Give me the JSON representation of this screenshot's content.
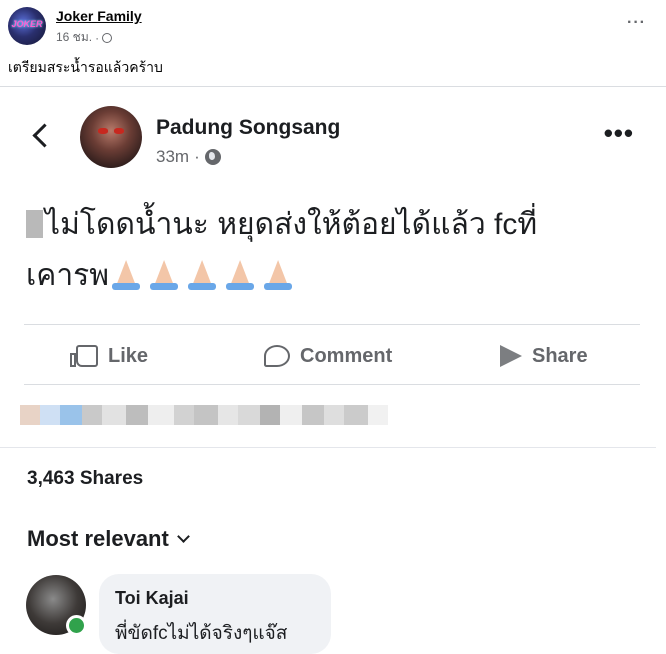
{
  "post": {
    "page_name": "Joker Family",
    "time": "16 ชม.",
    "separator": "·",
    "caption": "เตรียมสระน้ำรอแล้วคร้าบ",
    "more": "···",
    "avatar_text": "JOKER"
  },
  "shared": {
    "author": "Padung Songsang",
    "time": "33m",
    "separator": "·",
    "text_line1": "ไม่โดดน้ำนะ หยุดส่งให้ต้อยได้แล้ว fcที่",
    "text_line2": "เคารพ",
    "emoji": "folded-hands",
    "emoji_count": 5,
    "more": "•••",
    "actions": {
      "like": "Like",
      "comment": "Comment",
      "share": "Share"
    },
    "shares": "3,463 Shares",
    "sort": "Most relevant",
    "comment": {
      "author": "Toi Kajai",
      "text": "พี่ขัดfcไม่ได้จริงๆแจ๊ส"
    }
  },
  "colors": {
    "secondary_text": "#65676b",
    "online": "#31a24c",
    "bubble": "#f0f2f5"
  }
}
